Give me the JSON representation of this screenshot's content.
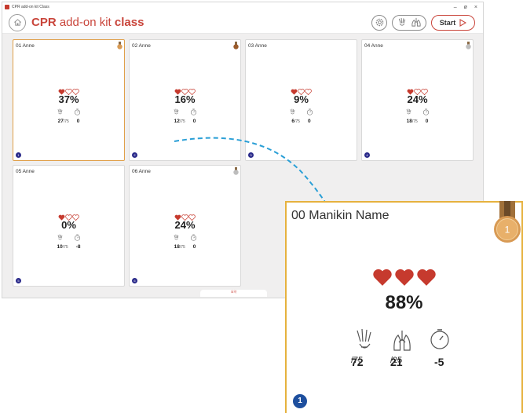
{
  "window": {
    "title": "CPR add-on kit Class",
    "controls": [
      "–",
      "ø",
      "×"
    ]
  },
  "header": {
    "brand_cpr": "CPR",
    "brand_addon": " add-on kit ",
    "brand_class": "class",
    "start_label": "Start"
  },
  "cards": [
    {
      "name": "01 Anne",
      "percent": "37%",
      "hearts_filled": 1,
      "compressions": "27",
      "compressions_total": "/75",
      "timer": "0",
      "number": "1",
      "medal": "gold",
      "selected": true
    },
    {
      "name": "02 Anne",
      "percent": "16%",
      "hearts_filled": 1,
      "compressions": "12",
      "compressions_total": "/75",
      "timer": "0",
      "number": "2",
      "medal": "bronze",
      "selected": false
    },
    {
      "name": "03 Anne",
      "percent": "9%",
      "hearts_filled": 1,
      "compressions": "6",
      "compressions_total": "/75",
      "timer": "0",
      "number": "3",
      "medal": "none",
      "selected": false
    },
    {
      "name": "04 Anne",
      "percent": "24%",
      "hearts_filled": 1,
      "compressions": "18",
      "compressions_total": "/75",
      "timer": "0",
      "number": "4",
      "medal": "silver",
      "selected": false
    },
    {
      "name": "05 Anne",
      "percent": "0%",
      "hearts_filled": 1,
      "compressions": "10",
      "compressions_total": "/75",
      "timer": "-8",
      "number": "5",
      "medal": "none",
      "selected": false
    },
    {
      "name": "06 Anne",
      "percent": "24%",
      "hearts_filled": 1,
      "compressions": "18",
      "compressions_total": "/75",
      "timer": "0",
      "number": "6",
      "medal": "silver",
      "selected": false
    }
  ],
  "bottom_tab": "요약",
  "zoom_card": {
    "name": "00 Manikin Name",
    "percent": "88%",
    "hearts_filled": 3,
    "compressions": "72",
    "compressions_total": "/75",
    "ventilations": "21",
    "ventilations_total": "/25",
    "timer": "-5",
    "number": "1",
    "medal_number": "1"
  },
  "colors": {
    "accent": "#c9453b",
    "heart": "#c63a2e",
    "selected_border": "#e6b23e",
    "number_badge": "#1e4f9e",
    "arrow": "#2a9fd6"
  }
}
